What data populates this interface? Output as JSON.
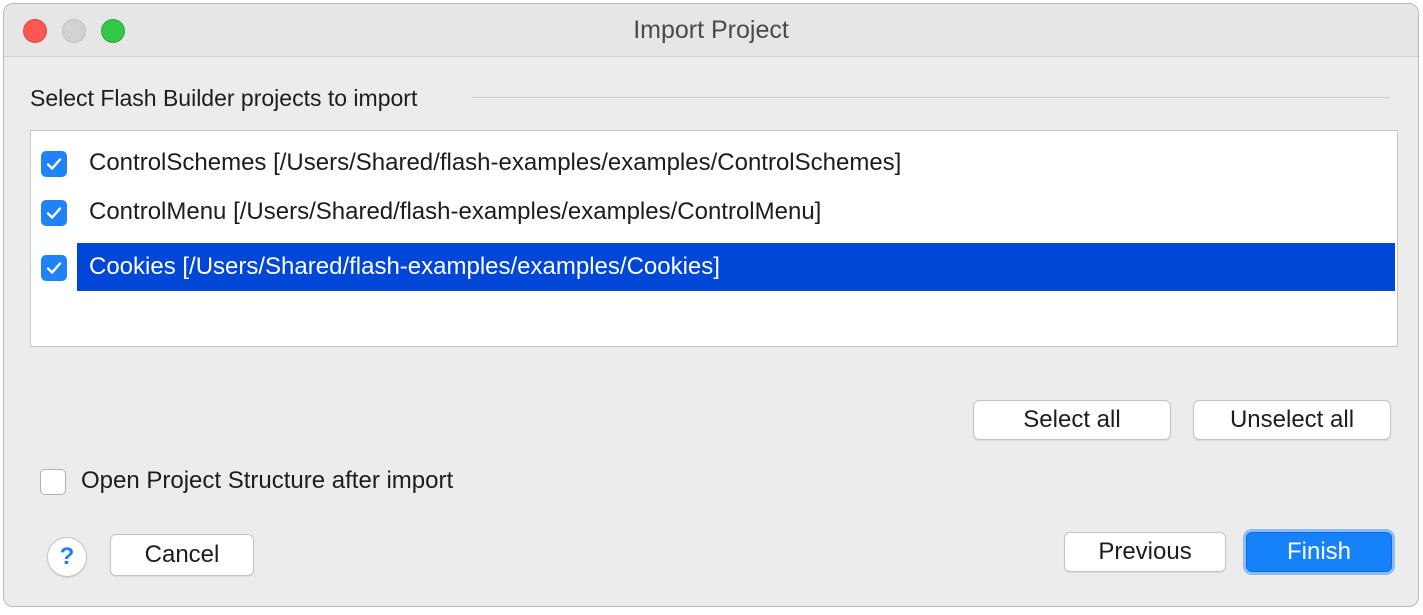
{
  "window": {
    "title": "Import Project"
  },
  "group": {
    "label": "Select Flash Builder projects to import"
  },
  "projects": [
    {
      "label": "ControlSchemes [/Users/Shared/flash-examples/examples/ControlSchemes]",
      "checked": true,
      "selected": false
    },
    {
      "label": "ControlMenu [/Users/Shared/flash-examples/examples/ControlMenu]",
      "checked": true,
      "selected": false
    },
    {
      "label": "Cookies [/Users/Shared/flash-examples/examples/Cookies]",
      "checked": true,
      "selected": true
    }
  ],
  "buttons": {
    "select_all": "Select all",
    "unselect_all": "Unselect all",
    "cancel": "Cancel",
    "previous": "Previous",
    "finish": "Finish",
    "help": "?"
  },
  "options": {
    "open_structure_label": "Open Project Structure after import",
    "open_structure_checked": false
  },
  "colors": {
    "accent": "#1682f9",
    "selection": "#0047d8",
    "close": "#fc5753",
    "zoom": "#33c748"
  }
}
